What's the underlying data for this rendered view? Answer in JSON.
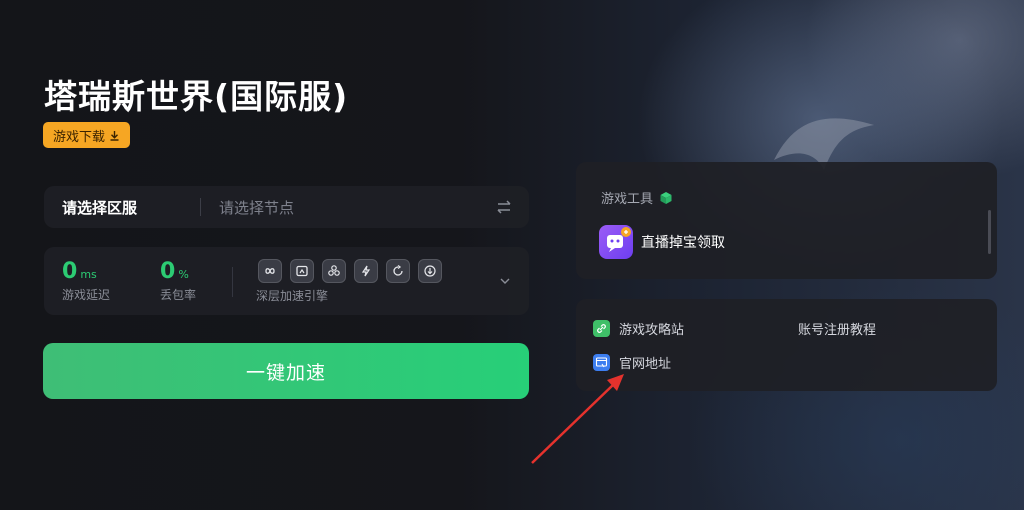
{
  "game": {
    "title": "塔瑞斯世界(国际服)",
    "download_label": "游戏下载"
  },
  "server": {
    "region_label": "请选择区服",
    "node_placeholder": "请选择节点"
  },
  "stats": {
    "latency_value": "0",
    "latency_unit": "ms",
    "latency_label": "游戏延迟",
    "packet_loss_value": "0",
    "packet_loss_unit": "%",
    "packet_loss_label": "丢包率",
    "engine_label": "深层加速引擎",
    "engine_icons": [
      "link-icon",
      "window-icon",
      "share-icon",
      "bolt-icon",
      "refresh-icon",
      "download-circle-icon"
    ]
  },
  "accelerate_button": "一键加速",
  "tools": {
    "title": "游戏工具",
    "items": [
      {
        "label": "直播掉宝领取",
        "icon": "live-drop-icon"
      }
    ]
  },
  "links": {
    "strategy": "游戏攻略站",
    "register_tutorial": "账号注册教程",
    "official_site": "官网地址"
  },
  "colors": {
    "accent_green": "#2ccb73",
    "download_orange": "#f6a623",
    "arrow_red": "#e5322d"
  }
}
